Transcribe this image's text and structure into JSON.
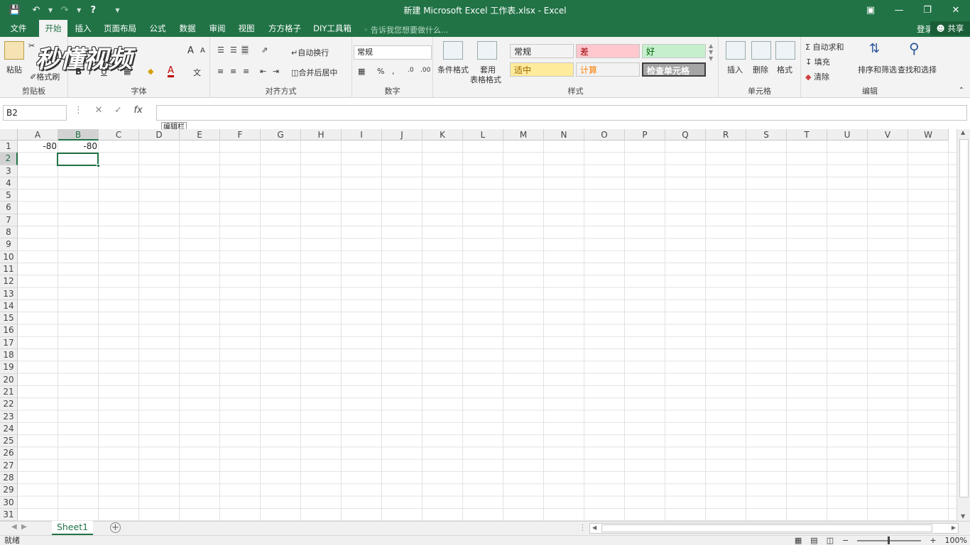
{
  "window": {
    "title": "新建 Microsoft Excel 工作表.xlsx - Excel"
  },
  "tabs": [
    "文件",
    "开始",
    "插入",
    "页面布局",
    "公式",
    "数据",
    "审阅",
    "视图",
    "方方格子",
    "DIY工具箱"
  ],
  "active_tab": "开始",
  "tellme": "告诉我您想要做什么...",
  "account": {
    "login": "登录",
    "share": "共享"
  },
  "watermark": "秒懂视频",
  "ribbon": {
    "clipboard": {
      "paste": "粘贴",
      "copy": "复制",
      "format_painter": "格式刷",
      "label": "剪贴板"
    },
    "font": {
      "bold": "B",
      "italic": "I",
      "underline": "U",
      "grow": "A",
      "shrink": "A",
      "font_color": "A",
      "phonetic": "文",
      "label": "字体"
    },
    "alignment": {
      "wrap": "自动换行",
      "merge": "合并后居中",
      "label": "对齐方式"
    },
    "number": {
      "format": "常规",
      "percent": "%",
      "comma": ",",
      "label": "数字"
    },
    "styles": {
      "conditional": "条件格式",
      "table_format_1": "套用",
      "table_format_2": "表格格式",
      "cells": [
        {
          "text": "常规",
          "bg": "#ffffff",
          "fg": "#000000"
        },
        {
          "text": "差",
          "bg": "#ffc7ce",
          "fg": "#9c0006"
        },
        {
          "text": "好",
          "bg": "#c6efce",
          "fg": "#006100"
        },
        {
          "text": "适中",
          "bg": "#ffeb9c",
          "fg": "#9c6500"
        },
        {
          "text": "计算",
          "bg": "#f2f2f2",
          "fg": "#fa7d00"
        },
        {
          "text": "检查单元格",
          "bg": "#a5a5a5",
          "fg": "#ffffff"
        }
      ],
      "label": "样式"
    },
    "cells": {
      "insert": "插入",
      "delete": "删除",
      "format": "格式",
      "label": "单元格"
    },
    "editing": {
      "autosum": "自动求和",
      "fill": "填充",
      "clear": "清除",
      "sort": "排序和筛选",
      "find": "查找和选择",
      "label": "编辑"
    }
  },
  "formula_bar": {
    "name_box": "B2",
    "value": "",
    "tooltip": "编辑栏"
  },
  "columns": [
    "A",
    "B",
    "C",
    "D",
    "E",
    "F",
    "G",
    "H",
    "I",
    "J",
    "K",
    "L",
    "M",
    "N",
    "O",
    "P",
    "Q",
    "R",
    "S",
    "T",
    "U",
    "V",
    "W"
  ],
  "rows": [
    "1",
    "2",
    "3",
    "4",
    "5",
    "6",
    "7",
    "8",
    "9",
    "10",
    "11",
    "12",
    "13",
    "14",
    "15",
    "16",
    "17",
    "18",
    "19",
    "20",
    "21",
    "22",
    "23",
    "24",
    "25",
    "26",
    "27",
    "28",
    "29",
    "30",
    "31"
  ],
  "cells": [
    {
      "ref": "A1",
      "value": "-80"
    },
    {
      "ref": "B1",
      "value": "-80"
    }
  ],
  "selected_cell": "B2",
  "sheets": [
    "Sheet1"
  ],
  "status": {
    "mode": "就绪",
    "zoom": "100%"
  },
  "colors": {
    "accent": "#217346"
  }
}
